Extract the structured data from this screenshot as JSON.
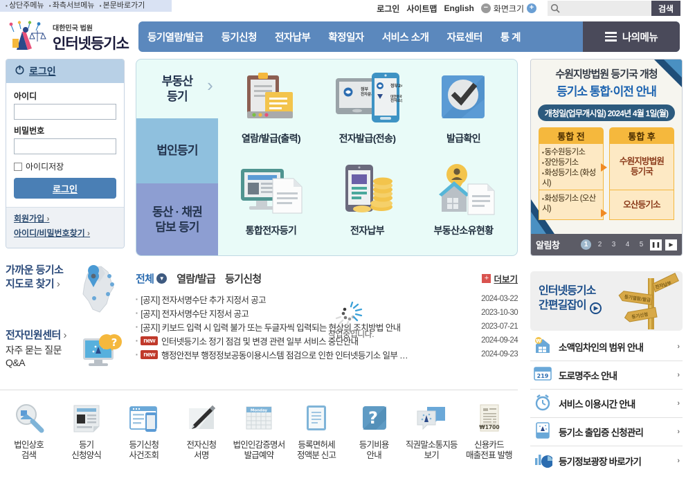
{
  "skiplinks": [
    "상단주메뉴",
    "좌측서브메뉴",
    "본문바로가기"
  ],
  "utility": {
    "login": "로그인",
    "sitemap": "사이트맵",
    "english": "English",
    "fontsize_label": "화면크기",
    "minus": "−",
    "plus": "+",
    "search_placeholder": "",
    "search_button": "검색"
  },
  "logo": {
    "court": "대한민국 법원",
    "name": "인터넷등기소"
  },
  "nav": {
    "items": [
      "등기열람/발급",
      "등기신청",
      "전자납부",
      "확정일자",
      "서비스 소개",
      "자료센터",
      "통 계"
    ],
    "mymenu": "나의메뉴"
  },
  "login_panel": {
    "title": "로그인",
    "id_label": "아이디",
    "id_value": "",
    "pw_label": "비밀번호",
    "pw_value": "",
    "save_id": "아이디저장",
    "submit": "로그인",
    "join": "회원가입",
    "find": "아이디/비밀번호찾기"
  },
  "find_office": {
    "line1": "가까운 등기소",
    "line2": "지도로 찾기"
  },
  "civil_center": {
    "title": "전자민원센터",
    "sub_line1": "자주 묻는 질문",
    "sub_line2": "Q&A"
  },
  "service_panel": {
    "tabs": [
      {
        "label": "부동산\n등기",
        "active": true
      },
      {
        "label": "법인등기",
        "active": false
      },
      {
        "label": "동산 · 채권\n담보 등기",
        "active": false
      }
    ],
    "items": [
      {
        "label": "열람/발급(출력)",
        "icon": "clipboard-document-icon"
      },
      {
        "label": "전자발급(전송)",
        "icon": "tablet-phone-icon"
      },
      {
        "label": "발급확인",
        "icon": "check-circle-icon"
      },
      {
        "label": "통합전자등기",
        "icon": "monitor-document-icon"
      },
      {
        "label": "전자납부",
        "icon": "phone-coins-icon"
      },
      {
        "label": "부동산소유현황",
        "icon": "house-person-icon"
      }
    ]
  },
  "banner": {
    "title_line1": "수원지방법원 등기국 개청",
    "title_line2": "등기소 통합·이전 안내",
    "date_badge": "개청일(업무개시일) 2024년 4월 1일(월)",
    "col_before_head": "통합 전",
    "col_after_head": "통합 후",
    "before_group1": [
      "동수원등기소",
      "장안등기소",
      "화성등기소 (화성시)"
    ],
    "before_group2": [
      "화성등기소 (오산시)"
    ],
    "after_group1": "수원지방법원\n등기국",
    "after_group2": "오산등기소",
    "footer_label": "알림창",
    "pages": [
      "1",
      "2",
      "3",
      "4",
      "5"
    ],
    "active_page": "1",
    "pause_icon": "❚❚",
    "next_icon": "▶"
  },
  "notices": {
    "tabs": [
      {
        "label": "전체",
        "active": true
      },
      {
        "label": "열람/발급",
        "active": false
      },
      {
        "label": "등기신청",
        "active": false
      }
    ],
    "more": "더보기",
    "loading_text": "작업중입니다.",
    "rows": [
      {
        "new": false,
        "title": "[공지] 전자서명수단 추가 지정서 공고",
        "date": "2024-03-22"
      },
      {
        "new": false,
        "title": "[공지] 전자서명수단 지정서 공고",
        "date": "2023-10-30"
      },
      {
        "new": false,
        "title": "[공지] 키보드 입력 시 입력 불가 또는 두글자씩 입력되는 현상의 조치방법 안내",
        "date": "2023-07-21"
      },
      {
        "new": true,
        "title": "인터넷등기소 정기 점검 및 변경 관련 일부 서비스 중단안내",
        "date": "2024-09-24"
      },
      {
        "new": true,
        "title": "행정안전부 행정정보공동이용시스템 점검으로 인한 인터넷등기소 일부 …",
        "date": "2024-09-23"
      }
    ]
  },
  "guide": {
    "banner_line1": "인터넷등기소",
    "banner_line2": "간편길잡이",
    "signs": [
      "등기열람/발급",
      "전자납부",
      "등기신청"
    ],
    "links": [
      {
        "label": "소액임차인의 범위 안내",
        "icon": "house-won-icon"
      },
      {
        "label": "도로명주소 안내",
        "icon": "address-plate-icon"
      },
      {
        "label": "서비스 이용시간 안내",
        "icon": "alarm-clock-icon"
      },
      {
        "label": "등기소 출입증 신청관리",
        "icon": "id-badge-icon"
      },
      {
        "label": "등기정보광장 바로가기",
        "icon": "bar-chart-icon"
      }
    ]
  },
  "quick_icons": [
    {
      "label": "법인상호\n검색",
      "icon": "magnifier-icon"
    },
    {
      "label": "등기\n신청양식",
      "icon": "document-form-icon"
    },
    {
      "label": "등기신청\n사건조회",
      "icon": "browser-phone-icon"
    },
    {
      "label": "전자신청\n서명",
      "icon": "pen-sign-icon"
    },
    {
      "label": "법인인감증명서\n발급예약",
      "icon": "calendar-icon"
    },
    {
      "label": "등록면허세\n정액분 신고",
      "icon": "blue-document-icon"
    },
    {
      "label": "등기비용\n안내",
      "icon": "question-mark-icon"
    },
    {
      "label": "직권말소통지등\n보기",
      "icon": "speech-bubbles-icon"
    },
    {
      "label": "신용카드\n매출전표 발행",
      "icon": "receipt-icon"
    }
  ],
  "colors": {
    "nav_blue": "#5b88bd",
    "mymenu_dark": "#4a4a5a",
    "panel_mint": "#e9fbf8",
    "tab_blue": "#8fc0de",
    "tab_purple": "#8d9ed2",
    "accent_orange": "#f5b83d",
    "new_red": "#c0392b"
  }
}
